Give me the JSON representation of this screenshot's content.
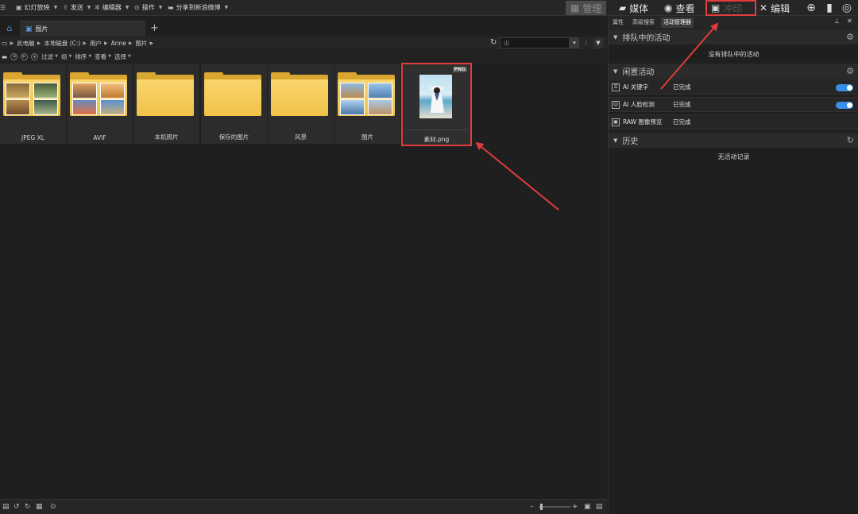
{
  "topbar": {
    "menu": [
      {
        "label": "幻灯放映",
        "icon": "slideshow-icon"
      },
      {
        "label": "发送",
        "icon": "send-icon"
      },
      {
        "label": "编辑器",
        "icon": "editor-icon"
      },
      {
        "label": "操作",
        "icon": "action-icon"
      },
      {
        "label": "分享到新浪微博",
        "icon": "share-folder-icon"
      }
    ],
    "modes": {
      "manage": "管理",
      "media": "媒体",
      "view": "查看",
      "develop": "冲印",
      "edit": "编辑"
    }
  },
  "tabs": {
    "current": "图片",
    "add": "+"
  },
  "address": {
    "crumbs": [
      "此电脑",
      "本地磁盘 (C:)",
      "用户",
      "Anne",
      "图片"
    ],
    "search_value": "山"
  },
  "toolbar2": {
    "filter": "过滤",
    "group": "组",
    "sort": "排序",
    "view": "查看",
    "select": "选择"
  },
  "thumbnails": [
    {
      "label": "JPEG XL",
      "kind": "folder-photos"
    },
    {
      "label": "AVIF",
      "kind": "folder-photos"
    },
    {
      "label": "本机照片",
      "kind": "folder-empty"
    },
    {
      "label": "保存的图片",
      "kind": "folder-empty"
    },
    {
      "label": "风景",
      "kind": "folder-empty"
    },
    {
      "label": "图片",
      "kind": "folder-photos"
    },
    {
      "label": "素材.png",
      "kind": "image",
      "badge": "PNG",
      "selected": true
    }
  ],
  "right_panel": {
    "tabs": [
      "属性",
      "高级搜索",
      "活动管理器"
    ],
    "active_tab": "活动管理器",
    "queued": {
      "title": "排队中的活动",
      "message": "没有排队中的活动"
    },
    "idle": {
      "title": "闲置活动",
      "items": [
        {
          "name": "AI 关键字",
          "status": "已完成",
          "toggle": true
        },
        {
          "name": "AI 人脸检测",
          "status": "已完成",
          "toggle": true
        },
        {
          "name": "RAW 图像预览",
          "status": "已完成",
          "toggle": false
        }
      ]
    },
    "history": {
      "title": "历史",
      "message": "无活动记录"
    }
  },
  "colors": {
    "highlight": "#e03c3c",
    "accent": "#3a8ee6",
    "folder": "#f5cc5a"
  }
}
